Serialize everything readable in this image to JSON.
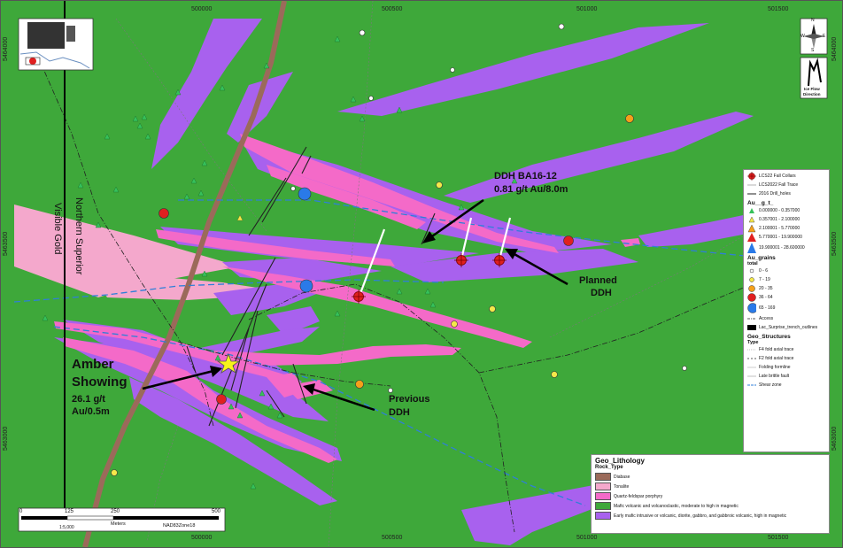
{
  "coords": {
    "easting": [
      "500000",
      "500500",
      "501000",
      "501500"
    ],
    "northing": [
      "5464000",
      "5463500",
      "5463000"
    ]
  },
  "annotations": {
    "amber_1": "Amber",
    "amber_2": "Showing",
    "amber_grade_1": "26.1 g/t",
    "amber_grade_2": "Au/0.5m",
    "ddh_1": "DDH BA16-12",
    "ddh_2": "0.81 g/t Au/8.0m",
    "planned_1": "Planned",
    "planned_2": "DDH",
    "previous_1": "Previous",
    "previous_2": "DDH",
    "trend_1": "Northern Superior",
    "trend_2": "Visible Gold"
  },
  "north": {
    "n": "N",
    "s": "S",
    "e": "E",
    "w": "W"
  },
  "ice": {
    "line1": "Ice Flow",
    "line2": "Direction"
  },
  "scale": {
    "ticks": [
      "0",
      "125",
      "250",
      "500"
    ],
    "units": "Meters",
    "ratio": "1:5,000",
    "datum": "NAD83Zone18"
  },
  "legend_right": {
    "collars": "LCS22 Fall Collars",
    "trace": "LCS2022 Fall Trace",
    "drill2016": "2016 Drill_holes",
    "au_title": "Au__g_t_",
    "au_classes": [
      "0.000000 - 0.357000",
      "0.357001 - 2.100000",
      "2.100001 - 5.770000",
      "5.770001 - 19.900000",
      "19.900001 - 28.600000"
    ],
    "grains_title_1": "Au_grains",
    "grains_title_2": "total",
    "grain_classes": [
      "0 - 6",
      "7 - 19",
      "20 - 35",
      "36 - 64",
      "65 - 169"
    ],
    "access": "Access",
    "trench": "Lac_Surprise_trench_outlines",
    "struct_title_1": "Geo_Structures",
    "struct_title_2": "Type",
    "structures": [
      "F4 fold axial trace",
      "F2 fold axial trace",
      "Folding formline",
      "Late brittle fault",
      "Shear zone"
    ]
  },
  "legend_litho": {
    "title": "Geo_Lithology",
    "subtitle": "Rock_Type",
    "units": [
      {
        "label": "Diabase",
        "color": "#9b6a5a"
      },
      {
        "label": "Tonalite",
        "color": "#f4a8cc"
      },
      {
        "label": "Quartz-feldspar porphyry",
        "color": "#f46ac8"
      },
      {
        "label": "Mafic volcanic and volcanoclastic, moderate to high in magnetic",
        "color": "#3ea83a"
      },
      {
        "label": "Early mafic intrusive or volcanic, diorite, gabbro, and gabbroic volcanic, high in magnetic",
        "color": "#a861ee"
      }
    ]
  },
  "colors": {
    "mafic": "#3ea83a",
    "intrusive": "#a861ee",
    "porphyry": "#f46ac8",
    "tonalite": "#f4a8cc",
    "diabase": "#9b6a5a",
    "shear": "#2f7fd8",
    "collar": "#e02020"
  }
}
